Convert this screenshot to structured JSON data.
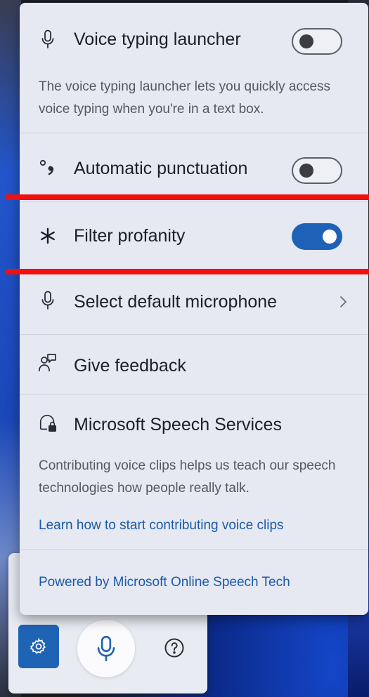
{
  "panel": {
    "voice_typing_launcher": {
      "label": "Voice typing launcher",
      "icon": "microphone-icon",
      "toggle_state": "off",
      "description": "The voice typing launcher lets you quickly access voice typing when you're in a text box."
    },
    "automatic_punctuation": {
      "label": "Automatic punctuation",
      "icon": "punctuation-icon",
      "toggle_state": "off"
    },
    "filter_profanity": {
      "label": "Filter profanity",
      "icon": "asterisk-icon",
      "toggle_state": "on"
    },
    "select_microphone": {
      "label": "Select default microphone",
      "icon": "microphone-icon"
    },
    "give_feedback": {
      "label": "Give feedback",
      "icon": "feedback-icon"
    },
    "speech_services": {
      "label": "Microsoft Speech Services",
      "icon": "speech-lock-icon",
      "description": "Contributing voice clips helps us teach our speech technologies how people really talk.",
      "link": "Learn how to start contributing voice clips"
    },
    "footer_link": "Powered by Microsoft Online Speech Tech"
  },
  "toolbar": {
    "settings_icon": "gear-icon",
    "mic_icon": "microphone-icon",
    "help_icon": "help-icon"
  },
  "colors": {
    "accent": "#1d62b7",
    "annotation": "#f01010",
    "link": "#1a5aa8"
  }
}
